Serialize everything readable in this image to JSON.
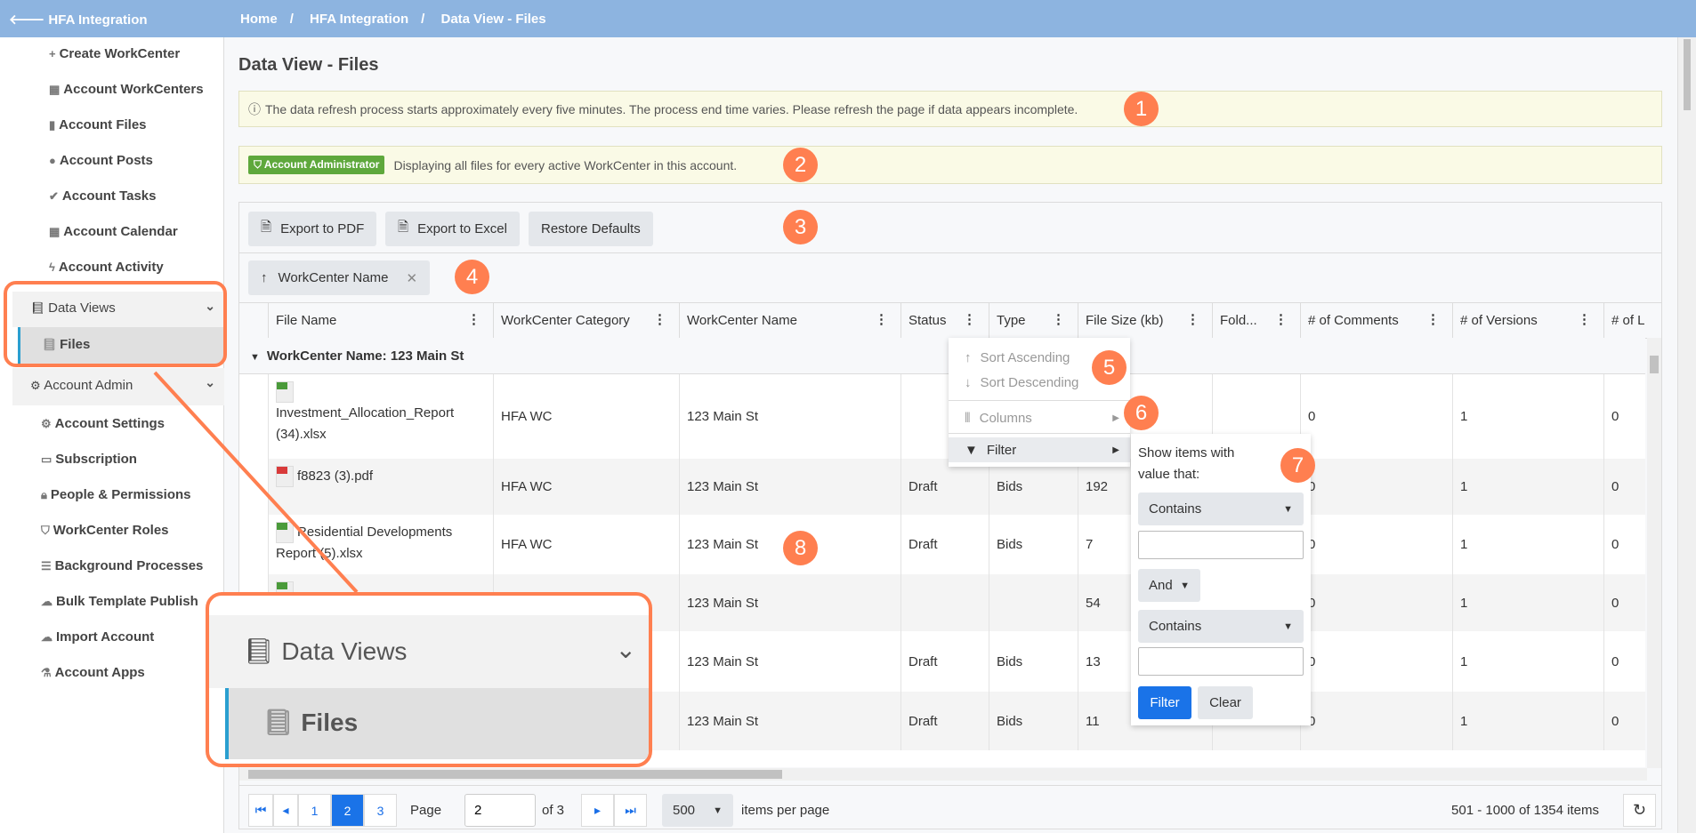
{
  "sidebar": {
    "back_label": "HFA Integration",
    "items": [
      {
        "icon": "plus-icon",
        "glyph": "+",
        "label": "Create WorkCenter"
      },
      {
        "icon": "grid-icon",
        "glyph": "▦",
        "label": "Account WorkCenters"
      },
      {
        "icon": "file-icon",
        "glyph": "▮",
        "label": "Account Files"
      },
      {
        "icon": "comments-icon",
        "glyph": "●",
        "label": "Account Posts"
      },
      {
        "icon": "check-icon",
        "glyph": "✔",
        "label": "Account Tasks"
      },
      {
        "icon": "calendar-icon",
        "glyph": "▦",
        "label": "Account Calendar"
      },
      {
        "icon": "bolt-icon",
        "glyph": "ϟ",
        "label": "Account Activity"
      }
    ],
    "data_views": {
      "label": "Data Views",
      "sub": "Files"
    },
    "admin": {
      "label": "Account Admin",
      "items": [
        {
          "icon": "gear-icon",
          "glyph": "⚙",
          "label": "Account Settings"
        },
        {
          "icon": "money-icon",
          "glyph": "▭",
          "label": "Subscription"
        },
        {
          "icon": "lock-icon",
          "glyph": "🔒︎",
          "label": "People & Permissions"
        },
        {
          "icon": "shield-icon",
          "glyph": "⛉",
          "label": "WorkCenter Roles"
        },
        {
          "icon": "list-icon",
          "glyph": "☰",
          "label": "Background Processes"
        },
        {
          "icon": "cloud-upload-icon",
          "glyph": "☁",
          "label": "Bulk Template Publish"
        },
        {
          "icon": "cloud-upload-icon",
          "glyph": "☁",
          "label": "Import Account"
        },
        {
          "icon": "flask-icon",
          "glyph": "⚗",
          "label": "Account Apps"
        }
      ]
    }
  },
  "breadcrumb": [
    "Home",
    "HFA Integration",
    "Data View - Files"
  ],
  "page_title": "Data View - Files",
  "alert_info": "The data refresh process starts approximately every five minutes. The process end time varies. Please refresh the page if data appears incomplete.",
  "alert_admin": {
    "badge": "Account Administrator",
    "text": "Displaying all files for every active WorkCenter in this account."
  },
  "toolbar": {
    "pdf": "Export to PDF",
    "excel": "Export to Excel",
    "restore": "Restore Defaults"
  },
  "group_chip": "WorkCenter Name",
  "columns": [
    "File Name",
    "WorkCenter Category",
    "WorkCenter Name",
    "Status",
    "Type",
    "File Size (kb)",
    "Fold...",
    "# of Comments",
    "# of Versions",
    "# of L"
  ],
  "group_row": "WorkCenter Name: 123 Main St",
  "rows": [
    {
      "type": "xlsx",
      "cells": [
        "Investment_Allocation_Report (34).xlsx",
        "HFA WC",
        "123 Main St",
        "",
        "",
        "",
        "",
        "0",
        "1",
        "0"
      ]
    },
    {
      "type": "pdf",
      "cells": [
        "f8823 (3).pdf",
        "HFA WC",
        "123 Main St",
        "Draft",
        "Bids",
        "192",
        "",
        "0",
        "1",
        "0"
      ]
    },
    {
      "type": "xlsx",
      "cells": [
        "Residential Developments Report (5).xlsx",
        "HFA WC",
        "123 Main St",
        "Draft",
        "Bids",
        "7",
        "",
        "0",
        "1",
        "0"
      ]
    },
    {
      "type": "xlsx",
      "cells": [
        "",
        "",
        "123 Main St",
        "",
        "",
        "54",
        "",
        "0",
        "1",
        "0"
      ]
    },
    {
      "type": "",
      "cells": [
        "",
        "",
        "123 Main St",
        "Draft",
        "Bids",
        "13",
        "",
        "0",
        "1",
        "0"
      ]
    },
    {
      "type": "",
      "cells": [
        "",
        "",
        "123 Main St",
        "Draft",
        "Bids",
        "11",
        "",
        "0",
        "1",
        "0"
      ]
    }
  ],
  "column_menu": {
    "sort_asc": "Sort Ascending",
    "sort_desc": "Sort Descending",
    "columns": "Columns",
    "filter": "Filter"
  },
  "filter_panel": {
    "title": "Show items with value that:",
    "op1": "Contains",
    "logic": "And",
    "op2": "Contains",
    "value1": "",
    "value2": "",
    "filter": "Filter",
    "clear": "Clear"
  },
  "pager": {
    "pages": [
      "1",
      "2",
      "3"
    ],
    "current": "2",
    "page_label": "Page",
    "page_value": "2",
    "of_label": "of 3",
    "page_size": "500",
    "per_page_label": "items per page",
    "summary": "501 - 1000 of 1354 items"
  },
  "annotations": [
    "1",
    "2",
    "3",
    "4",
    "5",
    "6",
    "7",
    "8"
  ],
  "colors": {
    "accent": "#1a73e8",
    "header": "#8db4e0",
    "annotation": "#ff7f50",
    "admin_badge": "#5ea83c"
  }
}
